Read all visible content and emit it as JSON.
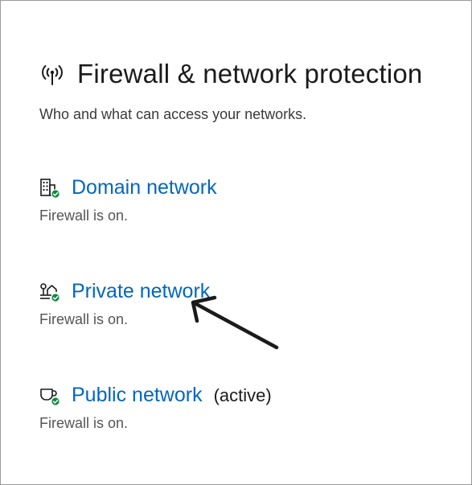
{
  "page": {
    "title": "Firewall & network protection",
    "subtitle": "Who and what can access your networks."
  },
  "networks": [
    {
      "icon": "domain-building-icon",
      "name": "Domain network",
      "active_label": "",
      "status": "Firewall is on."
    },
    {
      "icon": "private-house-icon",
      "name": "Private network",
      "active_label": "",
      "status": "Firewall is on."
    },
    {
      "icon": "public-coffee-icon",
      "name": "Public network",
      "active_label": "(active)",
      "status": "Firewall is on."
    }
  ],
  "colors": {
    "link": "#0067c0",
    "check_badge": "#10893e",
    "text": "#1b1b1b",
    "secondary_text": "#555555"
  },
  "annotation": {
    "icon": "pointer-arrow-icon",
    "points_to": "Private network"
  }
}
